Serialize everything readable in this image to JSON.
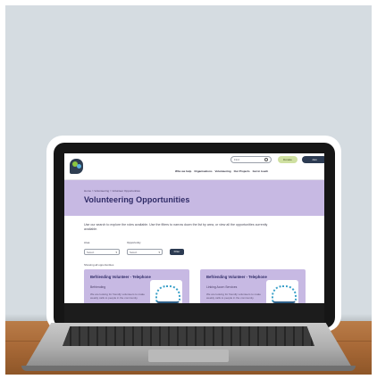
{
  "scene": {
    "description_colors": {
      "wall": "#d5dce1",
      "desk": "#a96a38",
      "screen_hero": "#c7b9e3",
      "title_color": "#2e2a66",
      "button_dark": "#2c3b52",
      "button_green": "#cfe0a1"
    }
  },
  "site": {
    "header": {
      "search_placeholder": "Find",
      "donate_label": "Donate",
      "member_label": "Join",
      "nav": [
        "Who we help",
        "Organisations",
        "Volunteering",
        "Our Projects",
        "Get in touch"
      ]
    },
    "hero": {
      "breadcrumb": "Home > Volunteering > Volunteer Opportunities",
      "title": "Volunteering Opportunities"
    },
    "intro": "Use our search to explore the roles available. Use the filters to narrow down the list by area, or view all the opportunities currently available.",
    "filters": {
      "area_label": "Area",
      "area_value": "Select",
      "type_label": "Opportunity",
      "type_value": "Select",
      "button_label": "Filter"
    },
    "result_count": "Showing all opportunities",
    "cards": [
      {
        "title": "Befriending Volunteer - Telephone",
        "subtitle": "Befriending",
        "text": "We are looking for friendly volunteers to make weekly calls to people in the community."
      },
      {
        "title": "Befriending Volunteer - Telephone",
        "subtitle": "Linking Acorn Services",
        "text": "We are looking for friendly volunteers to make weekly calls to people in the community."
      }
    ]
  }
}
